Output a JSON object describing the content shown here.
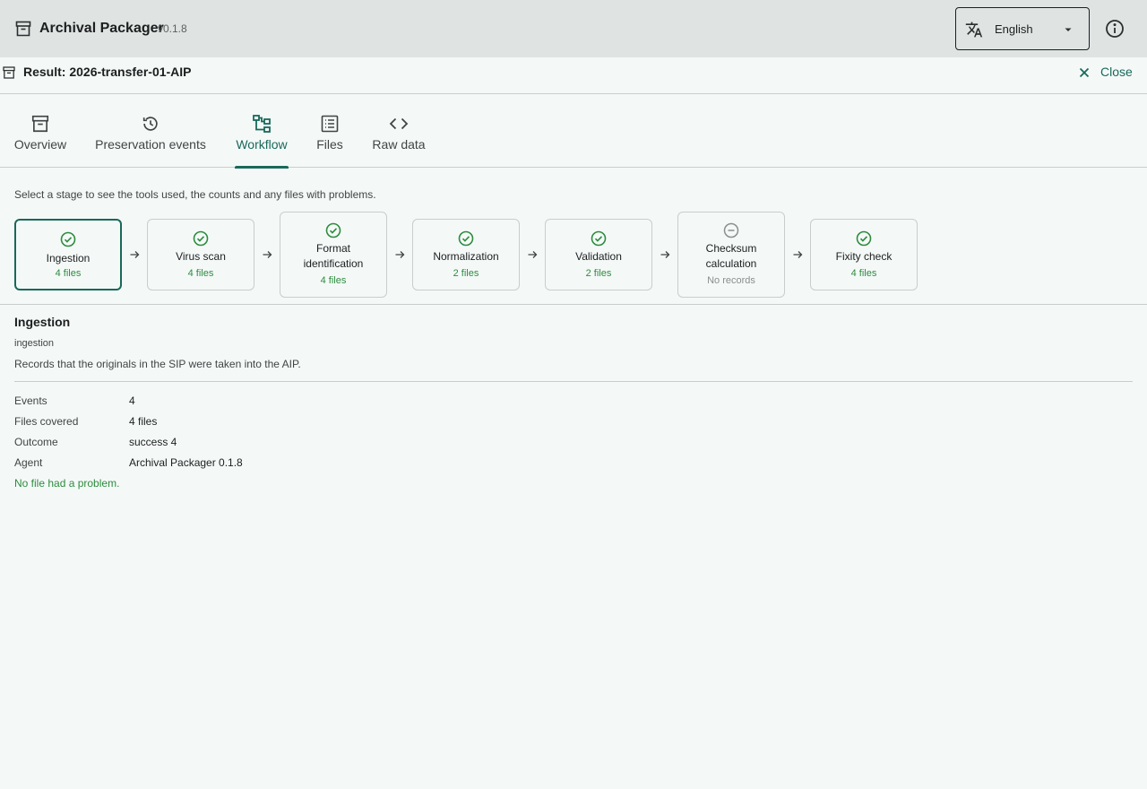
{
  "app": {
    "title": "Archival Packager",
    "version": "v0.1.8",
    "icon": "archive-box-icon",
    "language": {
      "selected": "English",
      "icon": "translate-icon"
    },
    "info_icon": "info-icon"
  },
  "result": {
    "title": "Result: 2026-transfer-01-AIP",
    "close_label": "Close"
  },
  "tabs": [
    {
      "label": "Overview",
      "icon": "archive-box-icon"
    },
    {
      "label": "Preservation events",
      "icon": "history-icon"
    },
    {
      "label": "Workflow",
      "icon": "workflow-icon",
      "active": true
    },
    {
      "label": "Files",
      "icon": "list-icon"
    },
    {
      "label": "Raw data",
      "icon": "code-icon"
    }
  ],
  "workflow": {
    "instruction": "Select a stage to see the tools used, the counts and any files with problems.",
    "stages": [
      {
        "name": "Ingestion",
        "count": "4 files",
        "status": "success",
        "selected": true
      },
      {
        "name": "Virus scan",
        "count": "4 files",
        "status": "success"
      },
      {
        "name": "Format identification",
        "count": "4 files",
        "status": "success"
      },
      {
        "name": "Normalization",
        "count": "2 files",
        "status": "success"
      },
      {
        "name": "Validation",
        "count": "2 files",
        "status": "success"
      },
      {
        "name": "Checksum calculation",
        "count": "No records",
        "status": "none"
      },
      {
        "name": "Fixity check",
        "count": "4 files",
        "status": "success"
      }
    ]
  },
  "detail": {
    "title": "Ingestion",
    "key": "ingestion",
    "description": "Records that the originals in the SIP were taken into the AIP.",
    "rows": [
      {
        "label": "Events",
        "value": "4"
      },
      {
        "label": "Files covered",
        "value": "4 files"
      },
      {
        "label": "Outcome",
        "value": "success 4"
      },
      {
        "label": "Agent",
        "value": "Archival Packager 0.1.8"
      }
    ],
    "message": "No file had a problem."
  },
  "colors": {
    "accent": "#18695a",
    "success": "#2e8b3e",
    "muted": "#8a8f8e",
    "appbar": "#dfe4e3",
    "background": "#f4f9f8"
  }
}
